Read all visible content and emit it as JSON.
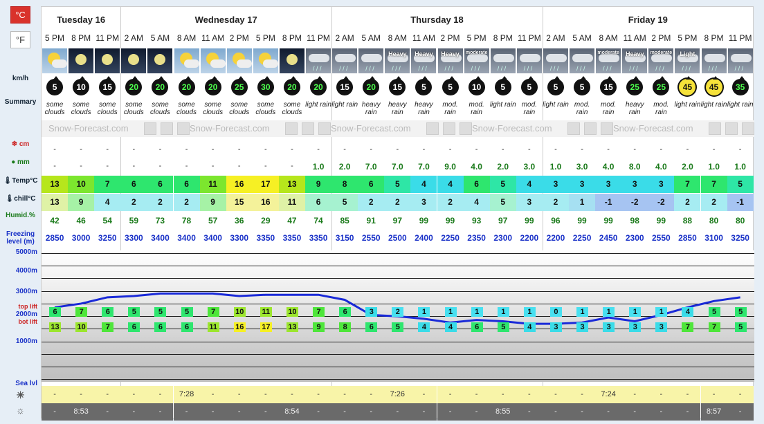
{
  "units": {
    "celsius": "°C",
    "fahrenheit": "°F"
  },
  "row_labels": {
    "wind": "km/h",
    "summary": "Summary",
    "snow": "cm",
    "rain": "mm",
    "temp": "Temp°C",
    "chill": "chill°C",
    "humid": "Humid.%",
    "freezing": "Freezing level (m)",
    "top_lift": "top lift",
    "bot_lift": "bot lift",
    "sea_level": "Sea lvl"
  },
  "altitude_labels": [
    "5000m",
    "4000m",
    "3000m",
    "2000m",
    "1000m"
  ],
  "watermark": "Snow-Forecast.com",
  "days": [
    {
      "name": "Tuesday 16",
      "span": 3
    },
    {
      "name": "Wednesday 17",
      "span": 8
    },
    {
      "name": "Thursday 18",
      "span": 8
    },
    {
      "name": "Friday 19",
      "span": 8
    }
  ],
  "times": [
    "5 PM",
    "8 PM",
    "11 PM",
    "2 AM",
    "5 AM",
    "8 AM",
    "11 AM",
    "2 PM",
    "5 PM",
    "8 PM",
    "11 PM",
    "2 AM",
    "5 AM",
    "8 AM",
    "11 AM",
    "2 PM",
    "5 PM",
    "8 PM",
    "11 PM",
    "2 AM",
    "5 AM",
    "8 AM",
    "11 AM",
    "2 PM",
    "5 PM",
    "8 PM",
    "11 PM"
  ],
  "sky": [
    {
      "kind": "day",
      "label": ""
    },
    {
      "kind": "night",
      "label": ""
    },
    {
      "kind": "night",
      "label": ""
    },
    {
      "kind": "night",
      "label": ""
    },
    {
      "kind": "night",
      "label": ""
    },
    {
      "kind": "day",
      "label": ""
    },
    {
      "kind": "day",
      "label": ""
    },
    {
      "kind": "day",
      "label": ""
    },
    {
      "kind": "day",
      "label": ""
    },
    {
      "kind": "night",
      "label": ""
    },
    {
      "kind": "rainy",
      "label": ""
    },
    {
      "kind": "rainy",
      "label": ""
    },
    {
      "kind": "rainy",
      "label": ""
    },
    {
      "kind": "rainy",
      "label": "Heavy"
    },
    {
      "kind": "rainy",
      "label": "Heavy"
    },
    {
      "kind": "rainy",
      "label": "Heavy"
    },
    {
      "kind": "rainy",
      "label": "moderate"
    },
    {
      "kind": "rainy",
      "label": ""
    },
    {
      "kind": "rainy",
      "label": ""
    },
    {
      "kind": "rainy",
      "label": ""
    },
    {
      "kind": "rainy",
      "label": ""
    },
    {
      "kind": "rainy",
      "label": "moderate"
    },
    {
      "kind": "rainy",
      "label": "Heavy"
    },
    {
      "kind": "rainy",
      "label": "moderate"
    },
    {
      "kind": "rainy",
      "label": "Light"
    },
    {
      "kind": "rainy",
      "label": ""
    },
    {
      "kind": "rainy",
      "label": ""
    }
  ],
  "wind": [
    "5",
    "10",
    "15",
    "20",
    "20",
    "20",
    "20",
    "25",
    "30",
    "20",
    "20",
    "15",
    "20",
    "15",
    "5",
    "5",
    "10",
    "5",
    "5",
    "5",
    "5",
    "15",
    "25",
    "25",
    "45",
    "45",
    "35"
  ],
  "summary": [
    "some clouds",
    "some clouds",
    "some clouds",
    "some clouds",
    "some clouds",
    "some clouds",
    "some clouds",
    "some clouds",
    "some clouds",
    "some clouds",
    "light rain",
    "light rain",
    "heavy rain",
    "heavy rain",
    "heavy rain",
    "mod. rain",
    "mod. rain",
    "light rain",
    "mod. rain",
    "light rain",
    "mod. rain",
    "mod. rain",
    "heavy rain",
    "mod. rain",
    "light rain",
    "light rain",
    "light rain"
  ],
  "snow": [
    "-",
    "-",
    "-",
    "-",
    "-",
    "-",
    "-",
    "-",
    "-",
    "-",
    "-",
    "-",
    "-",
    "-",
    "-",
    "-",
    "-",
    "-",
    "-",
    "-",
    "-",
    "-",
    "-",
    "-",
    "-",
    "-",
    "-"
  ],
  "rain": [
    "-",
    "-",
    "-",
    "-",
    "-",
    "-",
    "-",
    "-",
    "-",
    "-",
    "1.0",
    "2.0",
    "7.0",
    "7.0",
    "7.0",
    "9.0",
    "4.0",
    "2.0",
    "3.0",
    "1.0",
    "3.0",
    "4.0",
    "8.0",
    "4.0",
    "2.0",
    "1.0",
    "1.0"
  ],
  "temp": [
    "13",
    "10",
    "7",
    "6",
    "6",
    "6",
    "11",
    "16",
    "17",
    "13",
    "9",
    "8",
    "6",
    "5",
    "4",
    "4",
    "6",
    "5",
    "4",
    "3",
    "3",
    "3",
    "3",
    "3",
    "7",
    "7",
    "5"
  ],
  "chill": [
    "13",
    "9",
    "4",
    "2",
    "2",
    "2",
    "9",
    "15",
    "16",
    "11",
    "6",
    "5",
    "2",
    "2",
    "3",
    "2",
    "4",
    "5",
    "3",
    "2",
    "1",
    "-1",
    "-2",
    "-2",
    "2",
    "2",
    "-1"
  ],
  "humid": [
    "42",
    "46",
    "54",
    "59",
    "73",
    "78",
    "57",
    "36",
    "29",
    "47",
    "74",
    "85",
    "91",
    "97",
    "99",
    "99",
    "93",
    "97",
    "99",
    "96",
    "99",
    "99",
    "98",
    "99",
    "88",
    "80",
    "80"
  ],
  "freezing": [
    "2850",
    "3000",
    "3250",
    "3300",
    "3400",
    "3400",
    "3400",
    "3300",
    "3350",
    "3350",
    "3350",
    "3150",
    "2550",
    "2500",
    "2400",
    "2250",
    "2350",
    "2300",
    "2200",
    "2200",
    "2250",
    "2450",
    "2300",
    "2550",
    "2850",
    "3100",
    "3250"
  ],
  "top_lift": [
    "6",
    "7",
    "6",
    "5",
    "5",
    "5",
    "7",
    "10",
    "11",
    "10",
    "7",
    "6",
    "3",
    "2",
    "1",
    "1",
    "1",
    "1",
    "1",
    "0",
    "1",
    "1",
    "1",
    "1",
    "4",
    "5",
    "5"
  ],
  "bot_lift": [
    "13",
    "10",
    "7",
    "6",
    "6",
    "6",
    "11",
    "16",
    "17",
    "13",
    "9",
    "8",
    "6",
    "5",
    "4",
    "4",
    "6",
    "5",
    "4",
    "3",
    "3",
    "3",
    "3",
    "3",
    "7",
    "7",
    "5"
  ],
  "sunrise": [
    "-",
    "-",
    "-",
    "-",
    "-",
    "7:28",
    "-",
    "-",
    "-",
    "-",
    "-",
    "-",
    "-",
    "7:26",
    "-",
    "-",
    "-",
    "-",
    "-",
    "-",
    "-",
    "7:24",
    "-",
    "-",
    "-",
    "-",
    "-"
  ],
  "sunset": [
    "-",
    "8:53",
    "-",
    "-",
    "-",
    "-",
    "-",
    "-",
    "-",
    "8:54",
    "-",
    "-",
    "-",
    "-",
    "-",
    "-",
    "-",
    "8:55",
    "-",
    "-",
    "-",
    "-",
    "-",
    "-",
    "-",
    "8:57",
    "-"
  ],
  "colors": {
    "celsius_btn": "#d9322b",
    "freezing_line": "#1a2ad8",
    "label_blue": "#1a32c8",
    "label_red": "#cc2222",
    "label_green": "#1a7a1a"
  }
}
